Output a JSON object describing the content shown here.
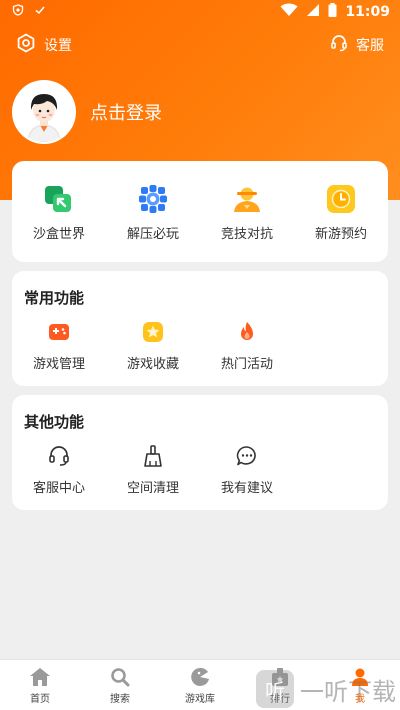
{
  "status_bar": {
    "time": "11:09"
  },
  "header": {
    "settings_label": "设置",
    "service_label": "客服",
    "login_text": "点击登录"
  },
  "top_grid": [
    {
      "label": "沙盒世界",
      "icon": "sandbox-icon"
    },
    {
      "label": "解压必玩",
      "icon": "relax-icon"
    },
    {
      "label": "竞技对抗",
      "icon": "competitive-icon"
    },
    {
      "label": "新游预约",
      "icon": "new-game-reserve-icon"
    }
  ],
  "common": {
    "title": "常用功能",
    "items": [
      {
        "label": "游戏管理",
        "icon": "gamepad-icon"
      },
      {
        "label": "游戏收藏",
        "icon": "star-icon"
      },
      {
        "label": "热门活动",
        "icon": "fire-icon"
      }
    ]
  },
  "other": {
    "title": "其他功能",
    "items": [
      {
        "label": "客服中心",
        "icon": "headset-icon"
      },
      {
        "label": "空间清理",
        "icon": "broom-icon"
      },
      {
        "label": "我有建议",
        "icon": "chat-icon"
      }
    ]
  },
  "tabs": [
    {
      "label": "首页",
      "icon": "home-icon"
    },
    {
      "label": "搜索",
      "icon": "search-icon"
    },
    {
      "label": "游戏库",
      "icon": "game-library-icon"
    },
    {
      "label": "排行",
      "icon": "ranking-icon"
    },
    {
      "label": "我",
      "icon": "profile-icon",
      "active": true
    }
  ],
  "watermark": {
    "badge": "听",
    "text": "一听下载"
  },
  "colors": {
    "accent": "#ff6a00",
    "card_bg": "#ffffff",
    "page_bg": "#efefef"
  }
}
